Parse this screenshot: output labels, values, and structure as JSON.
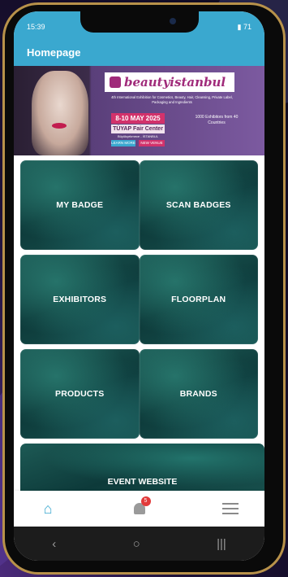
{
  "statusbar": {
    "time": "15:39",
    "battery": "71"
  },
  "appbar": {
    "title": "Homepage"
  },
  "banner": {
    "logo_text": "beautyistanbul",
    "subtitle": "4th International Exhibition for Cosmetics, Beauty, Hair, Cleansing, Private Label, Packaging and Ingredients",
    "dates": "8-10 MAY 2025",
    "venue": "TÜYAP Fair Center",
    "venue_sub": "Büyükçekmece - İSTANBUL",
    "button_1": "LEARN MORE",
    "button_2": "NEW VENUE",
    "stat": "1000 Exhibitors from 40 Countries"
  },
  "tiles": [
    {
      "label": "MY BADGE"
    },
    {
      "label": "SCAN BADGES"
    },
    {
      "label": "EXHIBITORS"
    },
    {
      "label": "FLOORPLAN"
    },
    {
      "label": "PRODUCTS"
    },
    {
      "label": "BRANDS"
    }
  ],
  "wide_tile": {
    "label": "EVENT WEBSITE"
  },
  "bottom_nav": {
    "notification_count": "5"
  },
  "system_nav": {
    "back": "‹",
    "home": "○",
    "recents": "|||"
  },
  "colors": {
    "accent": "#3aa8cf",
    "tile": "#0d3a3a",
    "badge": "#e23a3a"
  }
}
